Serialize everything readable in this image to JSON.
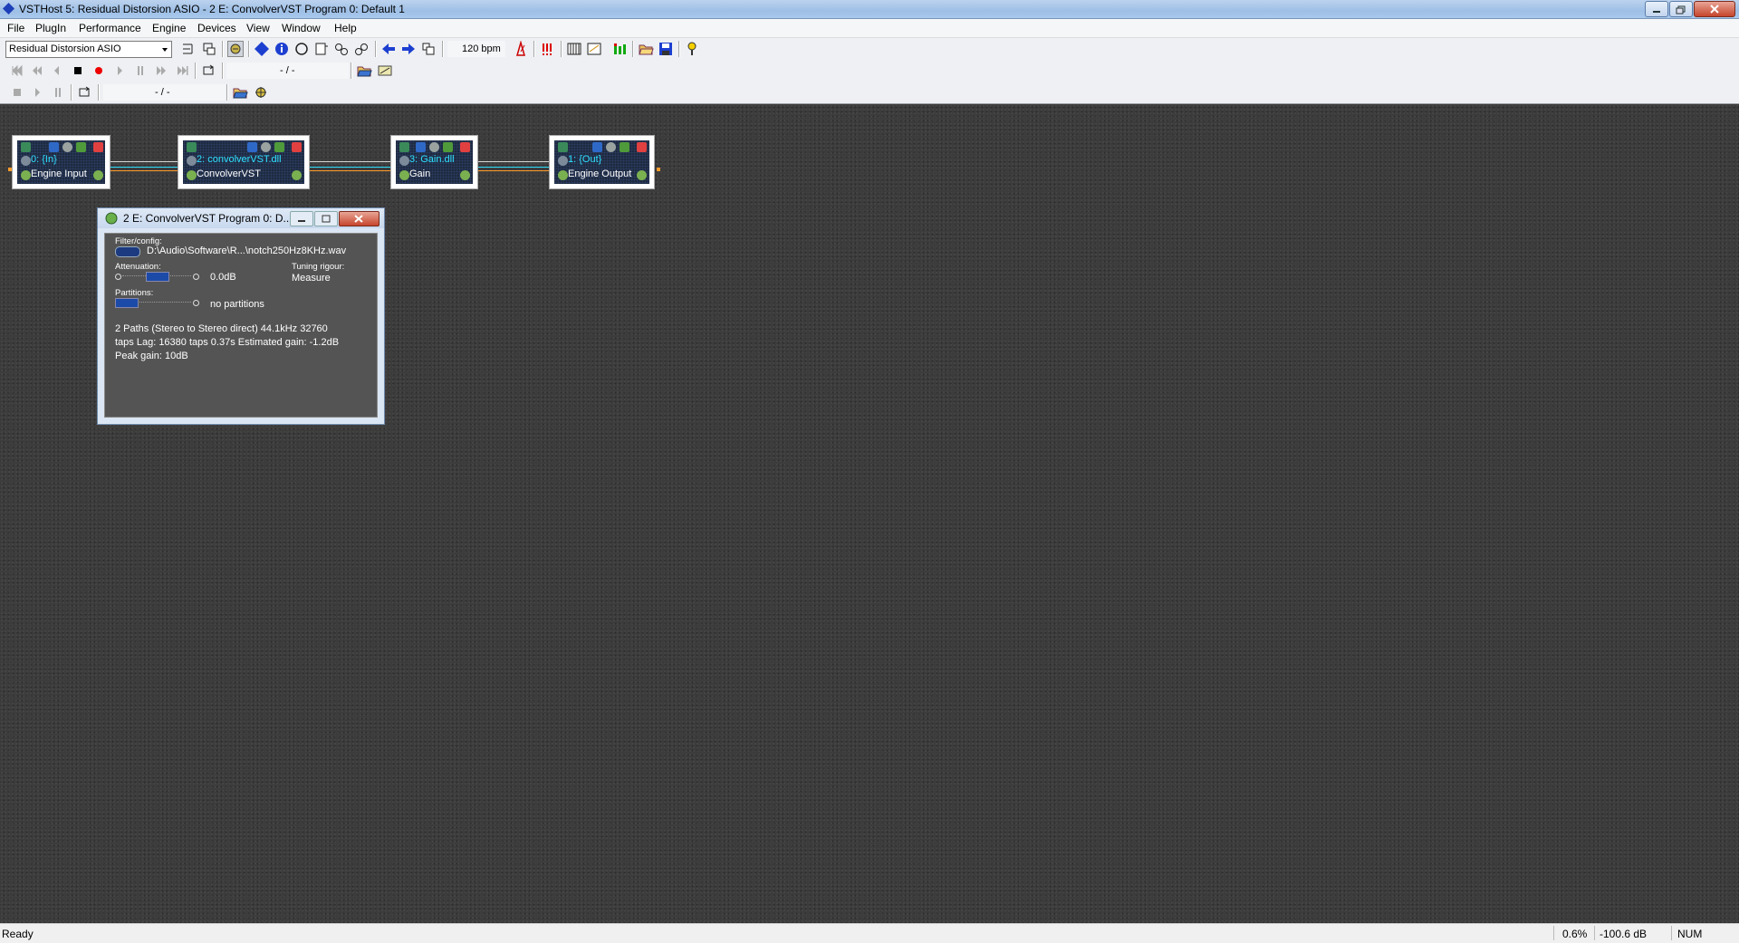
{
  "window": {
    "title": "VSTHost 5: Residual Distorsion ASIO - 2 E: ConvolverVST Program 0: Default 1"
  },
  "menu": [
    "File",
    "PlugIn",
    "Performance",
    "Engine",
    "Devices",
    "View",
    "Window",
    "Help"
  ],
  "toolbar": {
    "asio_device": "Residual Distorsion ASIO",
    "bpm": "120 bpm",
    "player_position": "- / -",
    "recorder_position": "- / -"
  },
  "nodes": [
    {
      "line1": "0: {In}",
      "line2": "Engine Input"
    },
    {
      "line1": "2: convolverVST.dll",
      "line2": "ConvolverVST"
    },
    {
      "line1": "3: Gain.dll",
      "line2": "Gain"
    },
    {
      "line1": "1: {Out}",
      "line2": "Engine Output"
    }
  ],
  "plugin_window": {
    "title": "2 E: ConvolverVST Program 0: D...",
    "filter_label": "Filter/config:",
    "filter_path": "D:\\Audio\\Software\\R...\\notch250Hz8KHz.wav",
    "attenuation_label": "Attenuation:",
    "attenuation_value": "0.0dB",
    "tuning_label": "Tuning rigour:",
    "tuning_value": "Measure",
    "partitions_label": "Partitions:",
    "partitions_value": "no partitions",
    "info_line1": "2 Paths (Stereo to Stereo direct) 44.1kHz 32760",
    "info_line2": "taps Lag: 16380 taps 0.37s Estimated gain: -1.2dB",
    "info_line3": "Peak gain: 10dB"
  },
  "status": {
    "ready": "Ready",
    "cpu": "0.6%",
    "level": "-100.6 dB",
    "num": "NUM"
  }
}
